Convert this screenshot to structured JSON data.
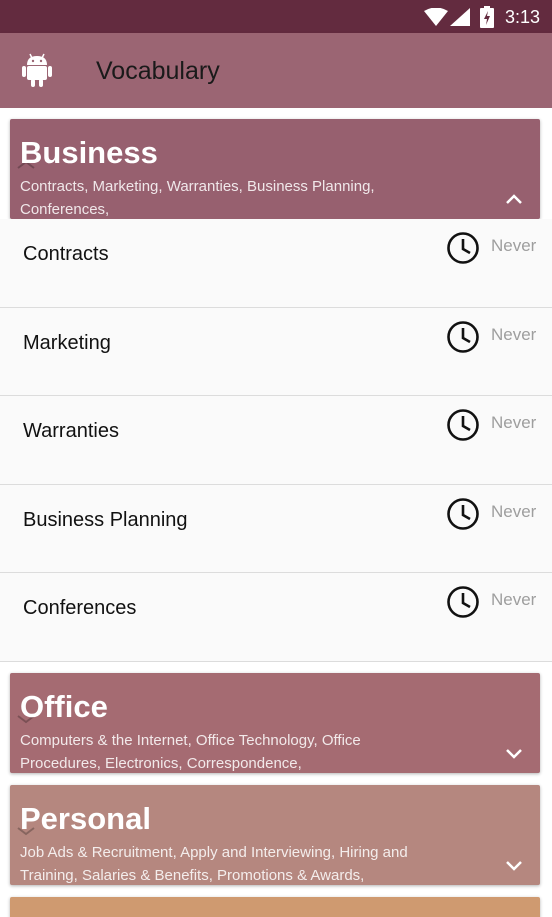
{
  "status_bar": {
    "time": "3:13",
    "icons": [
      "wifi-icon",
      "signal-icon",
      "battery-charging-icon"
    ]
  },
  "app_bar": {
    "title": "Vocabulary",
    "icon": "android-icon"
  },
  "categories": [
    {
      "title": "Business",
      "subtitle": "Contracts, Marketing, Warranties, Business Planning, Conferences,",
      "color": "#97606f",
      "expanded": true,
      "chevron": "chevron-up-icon",
      "topics": [
        {
          "label": "Contracts",
          "last_studied": "Never"
        },
        {
          "label": "Marketing",
          "last_studied": "Never"
        },
        {
          "label": "Warranties",
          "last_studied": "Never"
        },
        {
          "label": "Business Planning",
          "last_studied": "Never"
        },
        {
          "label": "Conferences",
          "last_studied": "Never"
        }
      ]
    },
    {
      "title": "Office",
      "subtitle": "Computers & the Internet, Office Technology, Office Procedures, Electronics, Correspondence,",
      "color": "#a56b72",
      "expanded": false,
      "chevron": "chevron-down-icon"
    },
    {
      "title": "Personal",
      "subtitle": "Job Ads & Recruitment, Apply and Interviewing, Hiring and Training, Salaries & Benefits, Promotions & Awards,",
      "color": "#b5877f",
      "expanded": false,
      "chevron": "chevron-down-icon"
    },
    {
      "title": "",
      "subtitle": "",
      "color": "#cf9a70",
      "expanded": false
    }
  ]
}
